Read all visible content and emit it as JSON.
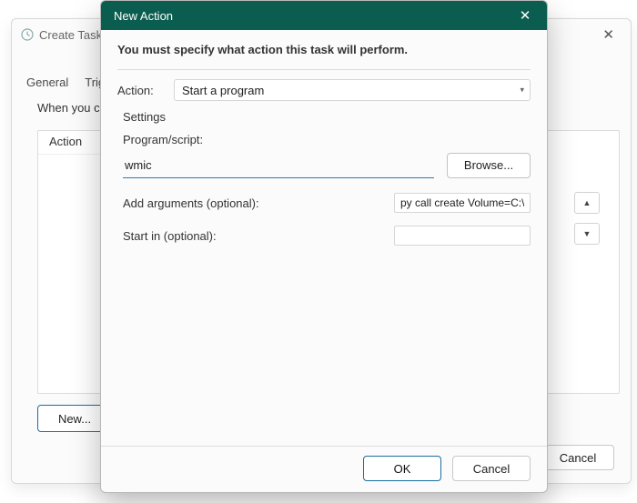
{
  "bg_window": {
    "title": "Create Task",
    "tabs": [
      "General",
      "Trig"
    ],
    "instruction": "When you c",
    "list_header": "Action",
    "new_button": "New...",
    "cancel_button": "Cancel"
  },
  "dialog": {
    "title": "New Action",
    "instruction": "You must specify what action this task will perform.",
    "action_label": "Action:",
    "action_selected": "Start a program",
    "settings_label": "Settings",
    "program_label": "Program/script:",
    "program_value": "wmic",
    "browse_label": "Browse...",
    "arguments_label": "Add arguments (optional):",
    "arguments_value": "py call create Volume=C:\\",
    "startin_label": "Start in (optional):",
    "startin_value": "",
    "ok_label": "OK",
    "cancel_label": "Cancel"
  }
}
